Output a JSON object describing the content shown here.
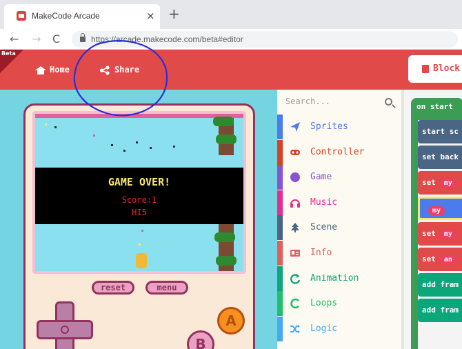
{
  "browser": {
    "tab_title": "MakeCode Arcade",
    "tab_close": "×",
    "new_tab": "+",
    "url": "https://arcade.makecode.com/beta#editor",
    "nav_back": "←",
    "nav_forward": "→",
    "nav_reload": "C"
  },
  "header": {
    "beta_label": "Beta",
    "home_label": "Home",
    "share_label": "Share",
    "blocks_label": "Block",
    "accent_color": "#e04a48"
  },
  "simulator": {
    "game_over": "GAME OVER!",
    "score": "Score:1",
    "high_score": "HI5",
    "reset_label": "reset",
    "menu_label": "menu",
    "a_label": "A",
    "b_label": "B"
  },
  "toolbox": {
    "search_placeholder": "Search...",
    "categories": [
      {
        "label": "Sprites",
        "icon": "paper-plane-icon",
        "color": "#4b7bec"
      },
      {
        "label": "Controller",
        "icon": "gamepad-icon",
        "color": "#d54322"
      },
      {
        "label": "Game",
        "icon": "circle-icon",
        "color": "#8854d0"
      },
      {
        "label": "Music",
        "icon": "headphones-icon",
        "color": "#e52d91"
      },
      {
        "label": "Scene",
        "icon": "tree-icon",
        "color": "#4b6584"
      },
      {
        "label": "Info",
        "icon": "id-card-icon",
        "color": "#e0605c"
      },
      {
        "label": "Animation",
        "icon": "refresh-icon",
        "color": "#0ba77b"
      },
      {
        "label": "Loops",
        "icon": "loop-icon",
        "color": "#20bf6b"
      },
      {
        "label": "Logic",
        "icon": "shuffle-icon",
        "color": "#45aaf2"
      }
    ]
  },
  "workspace": {
    "on_start": "on start",
    "blocks": [
      {
        "label": "start sc",
        "color": "#4b6584",
        "oval": ""
      },
      {
        "label": "set back",
        "color": "#4b6584",
        "oval": ""
      },
      {
        "label": "set",
        "color": "#e04a48",
        "oval": "my"
      },
      {
        "label": "",
        "color": "#4b7bec",
        "oval": "my"
      },
      {
        "label": "set",
        "color": "#e04a48",
        "oval": "my"
      },
      {
        "label": "set",
        "color": "#e04a48",
        "oval": "an"
      },
      {
        "label": "add fram",
        "color": "#0ba77b",
        "oval": ""
      },
      {
        "label": "add fram",
        "color": "#0ba77b",
        "oval": ""
      }
    ]
  }
}
